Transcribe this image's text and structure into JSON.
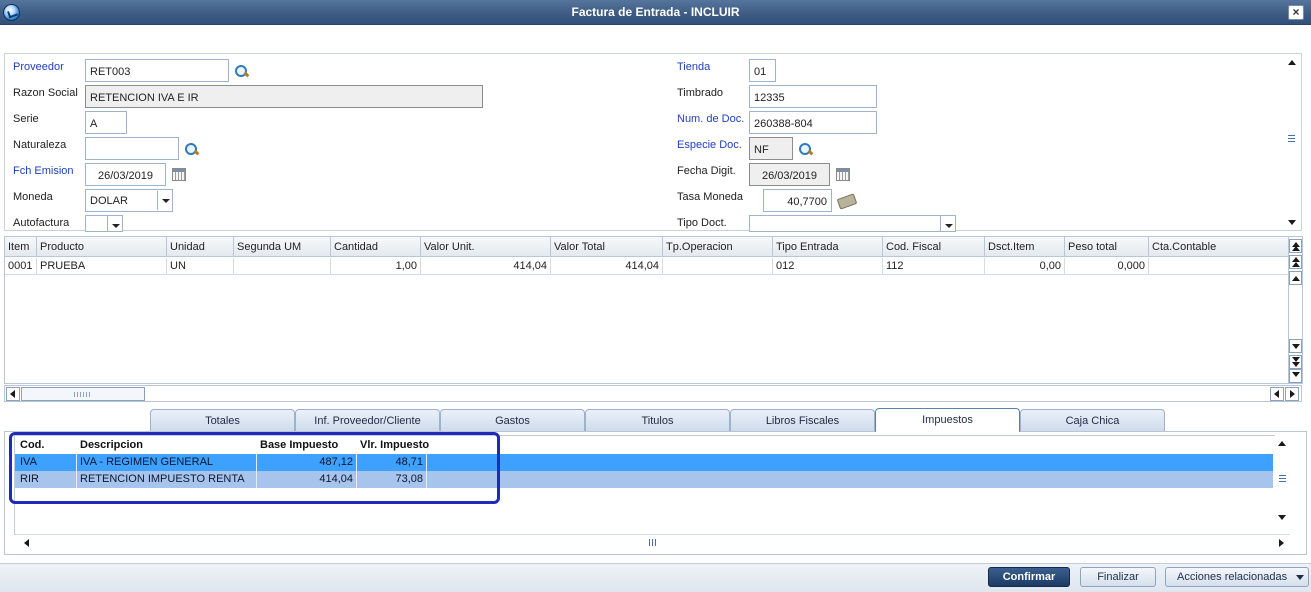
{
  "window": {
    "title": "Factura de Entrada - INCLUIR"
  },
  "form": {
    "proveedor": {
      "label": "Proveedor",
      "value": "RET003"
    },
    "razon_social": {
      "label": "Razon Social",
      "value": "RETENCION IVA E IR"
    },
    "serie": {
      "label": "Serie",
      "value": "A"
    },
    "naturaleza": {
      "label": "Naturaleza",
      "value": ""
    },
    "fch_emision": {
      "label": "Fch Emision",
      "value": "26/03/2019"
    },
    "moneda": {
      "label": "Moneda",
      "value": "DOLAR"
    },
    "autofactura": {
      "label": "Autofactura",
      "value": ""
    },
    "tienda": {
      "label": "Tienda",
      "value": "01"
    },
    "timbrado": {
      "label": "Timbrado",
      "value": "12335"
    },
    "num_doc": {
      "label": "Num. de Doc.",
      "value": "260388-804"
    },
    "especie_doc": {
      "label": "Especie Doc.",
      "value": "NF"
    },
    "fecha_digit": {
      "label": "Fecha Digit.",
      "value": "26/03/2019"
    },
    "tasa_moneda": {
      "label": "Tasa Moneda",
      "value": "40,7700"
    },
    "tipo_doct": {
      "label": "Tipo Doct.",
      "value": ""
    }
  },
  "items": {
    "headers": [
      "Item",
      "Producto",
      "Unidad",
      "Segunda UM",
      "Cantidad",
      "Valor Unit.",
      "Valor Total",
      "Tp.Operacion",
      "Tipo Entrada",
      "Cod. Fiscal",
      "Dsct.Item",
      "Peso total",
      "Cta.Contable"
    ],
    "rows": [
      [
        "0001",
        "PRUEBA",
        "UN",
        "",
        "1,00",
        "414,04",
        "414,04",
        "",
        "012",
        "112",
        "0,00",
        "0,000",
        ""
      ]
    ]
  },
  "tabs": [
    "Totales",
    "Inf. Proveedor/Cliente",
    "Gastos",
    "Titulos",
    "Libros Fiscales",
    "Impuestos",
    "Caja Chica"
  ],
  "active_tab": "Impuestos",
  "taxes": {
    "headers": [
      "Cod.",
      "Descripcion",
      "Base Impuesto",
      "Vlr. Impuesto"
    ],
    "rows": [
      [
        "IVA",
        "IVA - REGIMEN GENERAL",
        "487,12",
        "48,71"
      ],
      [
        "RIR",
        "RETENCION IMPUESTO RENTA",
        "414,04",
        "73,08"
      ]
    ]
  },
  "footer": {
    "confirm": "Confirmar",
    "finish": "Finalizar",
    "actions": "Acciones relacionadas"
  },
  "colors": {
    "title_bar": "#3d5b82",
    "selected_row": "#3ea1ff",
    "highlight_border": "#1f2bb8",
    "required_label": "#1f3fbf"
  },
  "icons": [
    "app-icon",
    "close-icon",
    "search-icon",
    "calendar-icon",
    "money-icon"
  ]
}
